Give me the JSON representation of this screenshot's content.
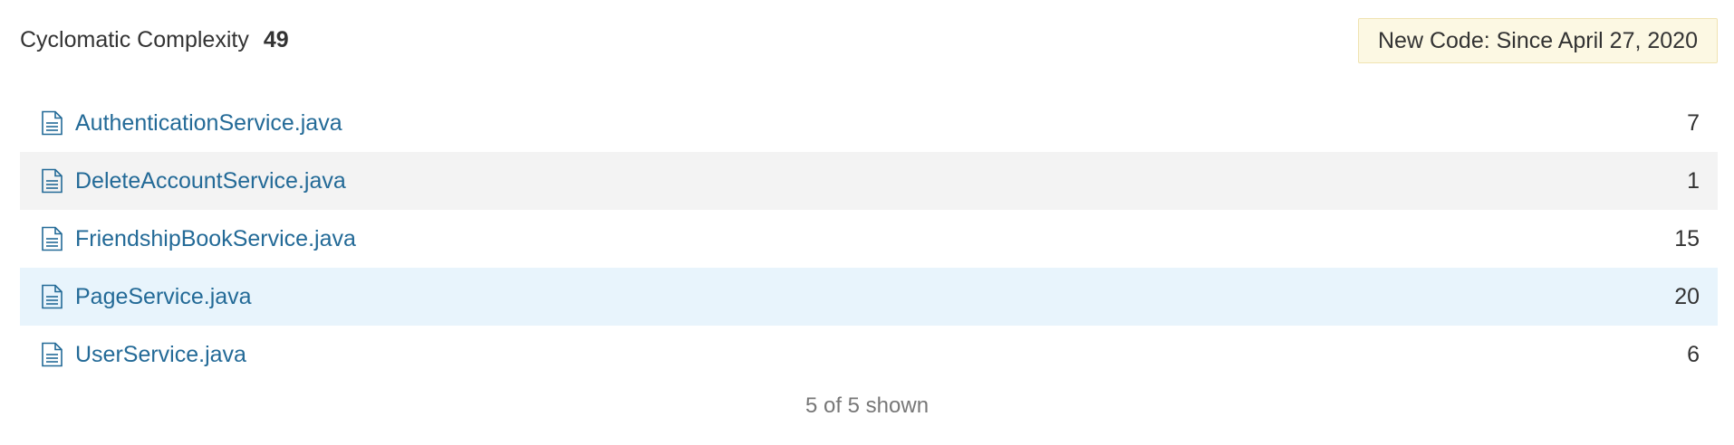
{
  "measure": {
    "name": "Cyclomatic Complexity",
    "value": "49"
  },
  "new_code": {
    "label": "New Code: Since April 27, 2020"
  },
  "files": [
    {
      "name": "AuthenticationService.java",
      "value": "7"
    },
    {
      "name": "DeleteAccountService.java",
      "value": "1"
    },
    {
      "name": "FriendshipBookService.java",
      "value": "15"
    },
    {
      "name": "PageService.java",
      "value": "20"
    },
    {
      "name": "UserService.java",
      "value": "6"
    }
  ],
  "footer": {
    "shown_text": "5 of 5 shown"
  },
  "colors": {
    "link": "#236a97",
    "selected_row": "#e8f4fc",
    "alt_row": "#f3f3f3",
    "new_code_bg": "#fcf8e3"
  },
  "icons": {
    "file": "file-text-icon"
  }
}
